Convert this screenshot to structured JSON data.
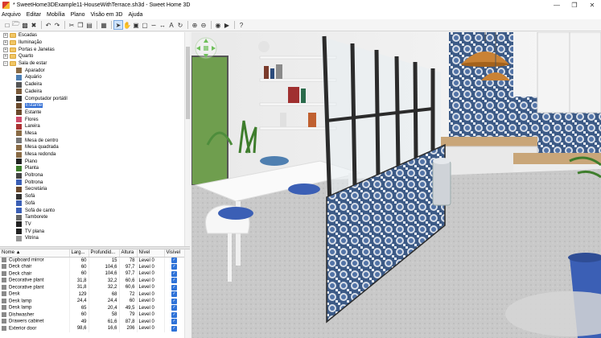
{
  "window": {
    "title": "* SweetHome3DExample11-HouseWithTerrace.sh3d - Sweet Home 3D"
  },
  "menu": [
    "Arquivo",
    "Editar",
    "Mobília",
    "Plano",
    "Visão em 3D",
    "Ajuda"
  ],
  "toolbar": {
    "icons": [
      "new-home-icon",
      "open-icon",
      "save-icon",
      "cut-tool-icon",
      "undo-icon",
      "redo-icon",
      "cut-icon",
      "copy-icon",
      "paste-icon",
      "add-furniture-icon",
      "select-icon",
      "pan-icon",
      "create-walls-icon",
      "create-rooms-icon",
      "create-polylines-icon",
      "create-dimensions-icon",
      "add-text-icon",
      "rotate-icon",
      "zoom-in-icon",
      "zoom-out-icon",
      "create-photo-icon",
      "create-video-icon",
      "help-icon"
    ]
  },
  "catalog": {
    "categories": [
      {
        "label": "Escadas",
        "expanded": false
      },
      {
        "label": "Iluminação",
        "expanded": false
      },
      {
        "label": "Portas e Janelas",
        "expanded": false
      },
      {
        "label": "Quarto",
        "expanded": false
      },
      {
        "label": "Sala de estar",
        "expanded": true
      }
    ],
    "items": [
      {
        "label": "Aparador",
        "selected": false
      },
      {
        "label": "Aquário",
        "selected": false
      },
      {
        "label": "Cadeira",
        "selected": false
      },
      {
        "label": "Cadeira",
        "selected": false
      },
      {
        "label": "Computador portátil",
        "selected": false
      },
      {
        "label": "Estante",
        "selected": true
      },
      {
        "label": "Estante",
        "selected": false
      },
      {
        "label": "Flores",
        "selected": false
      },
      {
        "label": "Lareira",
        "selected": false
      },
      {
        "label": "Mesa",
        "selected": false
      },
      {
        "label": "Mesa de centro",
        "selected": false
      },
      {
        "label": "Mesa quadrada",
        "selected": false
      },
      {
        "label": "Mesa redonda",
        "selected": false
      },
      {
        "label": "Piano",
        "selected": false
      },
      {
        "label": "Planta",
        "selected": false
      },
      {
        "label": "Poltrona",
        "selected": false
      },
      {
        "label": "Poltrona",
        "selected": false
      },
      {
        "label": "Secretária",
        "selected": false
      },
      {
        "label": "Sofá",
        "selected": false
      },
      {
        "label": "Sofá",
        "selected": false
      },
      {
        "label": "Sofá de canto",
        "selected": false
      },
      {
        "label": "Tamborete",
        "selected": false
      },
      {
        "label": "TV",
        "selected": false
      },
      {
        "label": "TV plana",
        "selected": false
      },
      {
        "label": "Vitrina",
        "selected": false
      }
    ]
  },
  "furniture_table": {
    "columns": [
      "Nome ▲",
      "Larg...",
      "Profundid...",
      "Altura",
      "Nível",
      "Visível"
    ],
    "rows": [
      [
        "Cupboard mirror",
        "60",
        "15",
        "78",
        "Level 0"
      ],
      [
        "Deck chair",
        "60",
        "104,6",
        "97,7",
        "Level 0"
      ],
      [
        "Deck chair",
        "60",
        "104,6",
        "97,7",
        "Level 0"
      ],
      [
        "Decorative plant",
        "31,8",
        "32,2",
        "60,6",
        "Level 0"
      ],
      [
        "Decorative plant",
        "31,8",
        "32,2",
        "60,6",
        "Level 0"
      ],
      [
        "Desk",
        "129",
        "68",
        "72",
        "Level 0"
      ],
      [
        "Desk lamp",
        "24,4",
        "24,4",
        "60",
        "Level 0"
      ],
      [
        "Desk lamp",
        "65",
        "20,4",
        "49,5",
        "Level 0"
      ],
      [
        "Dishwasher",
        "60",
        "58",
        "79",
        "Level 0"
      ],
      [
        "Drawers cabinet",
        "49",
        "61,6",
        "87,8",
        "Level 0"
      ],
      [
        "Exterior door",
        "98,6",
        "16,6",
        "206",
        "Level 0"
      ]
    ]
  }
}
